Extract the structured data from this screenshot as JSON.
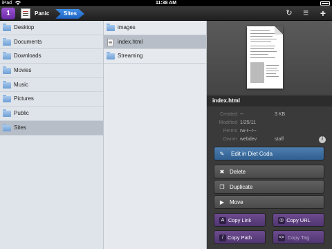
{
  "status_bar": {
    "carrier": "iPad",
    "time": "11:38 AM"
  },
  "toolbar": {
    "app_icon_label": "1",
    "breadcrumb": [
      "Panic",
      "Sites"
    ],
    "refresh_icon": "refresh-icon",
    "edit_icon": "edit-list-icon",
    "add_icon": "plus-icon"
  },
  "column1": {
    "items": [
      {
        "label": "Desktop",
        "icon": "folder-icon"
      },
      {
        "label": "Documents",
        "icon": "folder-icon"
      },
      {
        "label": "Downloads",
        "icon": "folder-icon"
      },
      {
        "label": "Movies",
        "icon": "folder-icon"
      },
      {
        "label": "Music",
        "icon": "folder-icon"
      },
      {
        "label": "Pictures",
        "icon": "folder-icon"
      },
      {
        "label": "Public",
        "icon": "folder-icon"
      },
      {
        "label": "Sites",
        "icon": "folder-icon",
        "selected": true
      }
    ]
  },
  "column2": {
    "items": [
      {
        "label": "images",
        "icon": "folder-icon"
      },
      {
        "label": "index.html",
        "icon": "file-icon",
        "selected": true
      },
      {
        "label": "Streaming",
        "icon": "folder-icon"
      }
    ]
  },
  "info": {
    "filename": "index.html",
    "meta": {
      "created_label": "Created",
      "created_value": "--",
      "size_value": "3 KB",
      "modified_label": "Modified",
      "modified_value": "1/25/11",
      "perms_label": "Perms",
      "perms_value": "rw-r--r--",
      "owner_label": "Owner",
      "owner_value": "webdev",
      "group_value": "staff"
    }
  },
  "actions": {
    "edit": "Edit in Diet Coda",
    "delete": "Delete",
    "duplicate": "Duplicate",
    "move": "Move",
    "copy_link": "Copy Link",
    "copy_url": "Copy URL",
    "copy_path": "Copy Path",
    "copy_tag": "Copy Tag"
  },
  "colors": {
    "accent": "#2f6fd0",
    "edit_button": "#3f6f9f",
    "copy_button": "#5c3f7e",
    "selection": "#b7bec7"
  }
}
